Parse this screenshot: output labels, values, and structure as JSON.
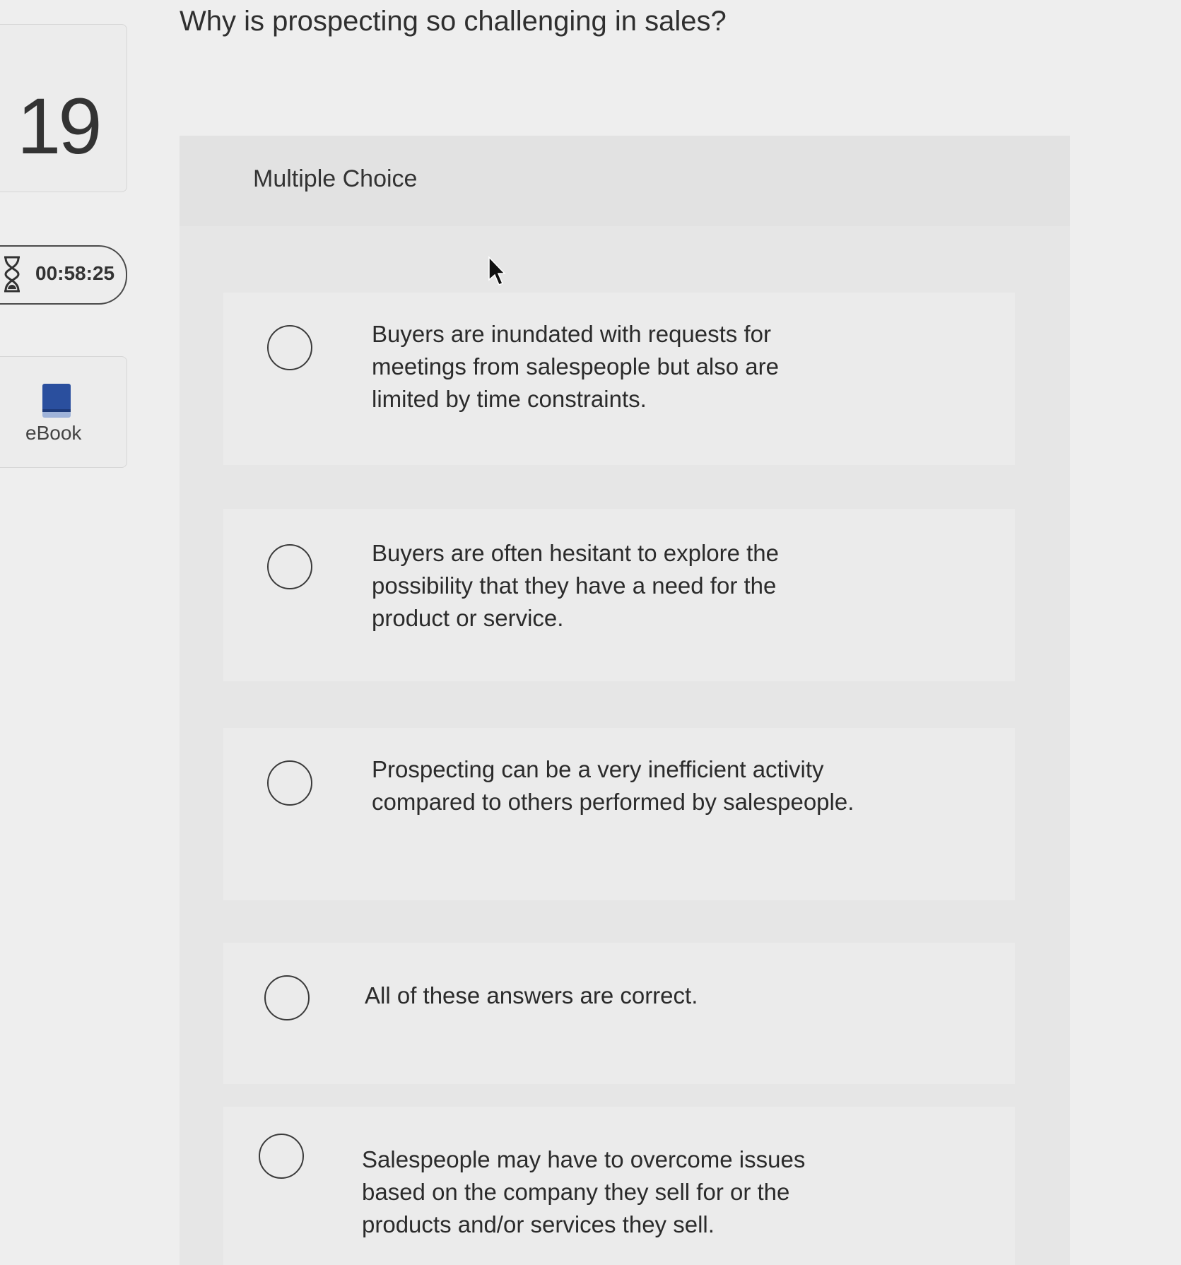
{
  "question": {
    "number": "19",
    "title": "Why is prospecting so challenging in sales?",
    "type_label": "Multiple Choice"
  },
  "timer": {
    "value": "00:58:25",
    "icon": "hourglass-icon"
  },
  "ebook": {
    "label": "eBook",
    "icon": "book-icon",
    "icon_color": "#2a4f9e"
  },
  "options": [
    {
      "text": "Buyers are inundated with requests for meetings from salespeople but also are limited by time constraints.",
      "selected": false
    },
    {
      "text": "Buyers are often hesitant to explore the possibility that they have a need for the product or service.",
      "selected": false
    },
    {
      "text": "Prospecting can be a very inefficient activity compared to others performed by salespeople.",
      "selected": false
    },
    {
      "text": "All of these answers are correct.",
      "selected": false
    },
    {
      "text": "Salespeople may have to overcome issues based on the company they sell for or the products and/or services they sell.",
      "selected": false
    }
  ]
}
